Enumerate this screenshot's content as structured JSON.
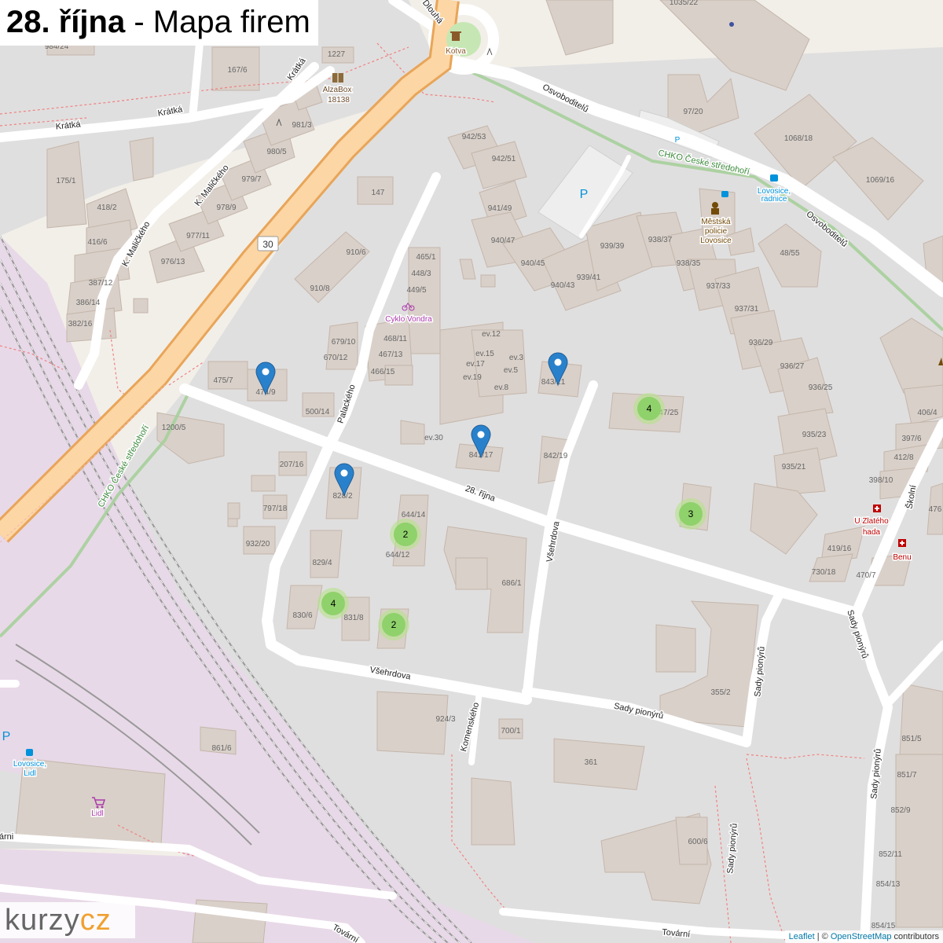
{
  "title": {
    "street": "28. října",
    "rest": " - Mapa firem"
  },
  "logo": {
    "part1": "kurzy",
    "part2": "cz"
  },
  "attribution": {
    "leaflet": "Leaflet",
    "sep": " | © ",
    "osm": "OpenStreetMap",
    "contrib": " contributors"
  },
  "colors": {
    "land": "#f2efe9",
    "residential": "#e0dfdf",
    "building": "#d9d0c9",
    "building_outline": "#c4b6ab",
    "rail_land": "#e8d9e8",
    "trunk": "#fcd6a4",
    "trunk_casing": "#e8a559",
    "cluster": "#8fd16b",
    "marker": "#2a81cb",
    "green_route": "#a6cf9b"
  },
  "streets": [
    {
      "label": "28. října"
    },
    {
      "label": "Palackého"
    },
    {
      "label": "Všehrdova"
    },
    {
      "label": "Všehrdova"
    },
    {
      "label": "Sady pionýrů"
    },
    {
      "label": "Sady pionýrů"
    },
    {
      "label": "Sady pionýrů"
    },
    {
      "label": "Sady pionýrů"
    },
    {
      "label": "Sady pionýrů"
    },
    {
      "label": "Osvoboditelů"
    },
    {
      "label": "Osvoboditelů"
    },
    {
      "label": "Dlouhá"
    },
    {
      "label": "Krátká"
    },
    {
      "label": "Krátká"
    },
    {
      "label": "Krátká"
    },
    {
      "label": "K. Maličkého"
    },
    {
      "label": "K. Maličkého"
    },
    {
      "label": "Komenského"
    },
    {
      "label": "Školní"
    },
    {
      "label": "Tovární"
    },
    {
      "label": "Tovární"
    },
    {
      "label": "árni"
    },
    {
      "label": "CHKO České středohoří"
    },
    {
      "label": "CHKO České středohoří"
    }
  ],
  "house_numbers": [
    "984/24",
    "1227",
    "167/6",
    "981/3",
    "980/5",
    "979/7",
    "978/9",
    "977/11",
    "976/13",
    "175/1",
    "418/2",
    "416/6",
    "387/12",
    "386/14",
    "382/16",
    "147",
    "942/53",
    "942/51",
    "941/49",
    "940/47",
    "940/45",
    "940/43",
    "939/39",
    "939/41",
    "938/37",
    "938/35",
    "937/33",
    "937/31",
    "936/29",
    "936/27",
    "936/25",
    "935/23",
    "935/21",
    "1035/22",
    "97/20",
    "1068/18",
    "1069/16",
    "48/55",
    "910/6",
    "910/8",
    "465/1",
    "448/3",
    "449/5",
    "468/11",
    "467/13",
    "466/15",
    "679/10",
    "670/12",
    "475/7",
    "474/9",
    "500/14",
    "1200/5",
    "207/16",
    "797/18",
    "932/20",
    "828/2",
    "829/4",
    "830/6",
    "831/8",
    "644/14",
    "644/12",
    "686/1",
    "842/19",
    "843/21",
    "841/17",
    "847/25",
    "ev.12",
    "ev.15",
    "ev.17",
    "ev.19",
    "ev.3",
    "ev.5",
    "ev.8",
    "ev.30",
    "924/3",
    "700/1",
    "361",
    "355/2",
    "600/6",
    "861/6",
    "406/4",
    "397/6",
    "412/8",
    "398/10",
    "419/16",
    "470/7",
    "730/18",
    "851/5",
    "851/7",
    "852/9",
    "852/11",
    "854/13",
    "854/15",
    "476"
  ],
  "pois": [
    {
      "label": "Kotva",
      "color": "#8b5a2b"
    },
    {
      "label": "AlzaBox",
      "color": "#6b4a2b"
    },
    {
      "label": "18138",
      "color": "#6b4a2b"
    },
    {
      "label": "Cyklo Vondra",
      "color": "#ac39ac"
    },
    {
      "label": "Městská",
      "color": "#734a08"
    },
    {
      "label": "policie",
      "color": "#734a08"
    },
    {
      "label": "Lovosice",
      "color": "#734a08"
    },
    {
      "label": "Lovosice,",
      "color": "#0092da"
    },
    {
      "label": "radnice",
      "color": "#0092da"
    },
    {
      "label": "U Zlatého",
      "color": "#bf0000"
    },
    {
      "label": "hada",
      "color": "#bf0000"
    },
    {
      "label": "Benu",
      "color": "#bf0000"
    },
    {
      "label": "Lidl",
      "color": "#ac39ac"
    },
    {
      "label": "Lovosice,",
      "color": "#0092da"
    },
    {
      "label": "Lidl",
      "color": "#0092da"
    }
  ],
  "parking": [
    {
      "label": "P"
    },
    {
      "label": "P"
    },
    {
      "label": "P"
    }
  ],
  "road_shield": {
    "label": "30"
  },
  "clusters": [
    {
      "count": "4"
    },
    {
      "count": "3"
    },
    {
      "count": "2"
    },
    {
      "count": "4"
    },
    {
      "count": "2"
    }
  ],
  "markers": [
    {
      "name": "marker-474-9"
    },
    {
      "name": "marker-843-21"
    },
    {
      "name": "marker-841-17"
    },
    {
      "name": "marker-828-2"
    }
  ]
}
